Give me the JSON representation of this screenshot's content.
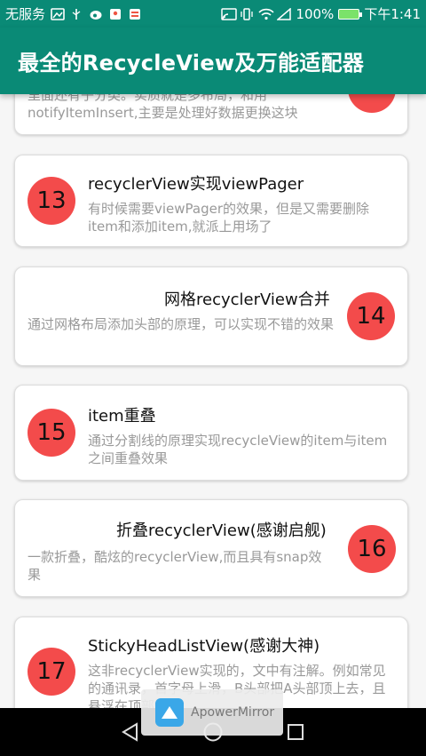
{
  "status_bar": {
    "carrier": "无服务",
    "battery": "100%",
    "time": "下午1:41"
  },
  "app_bar": {
    "title": "最全的RecycleView及万能适配器"
  },
  "cards": [
    {
      "number": "",
      "title": "",
      "description": "里面还有子分类。实质就是多布局，和用notifyItemInsert,主要是处理好数据更换这块"
    },
    {
      "number": "13",
      "title": "recyclerView实现viewPager",
      "description": "有时候需要viewPager的效果，但是又需要删除item和添加item,就派上用场了"
    },
    {
      "number": "14",
      "title": "网格recyclerView合并",
      "description": "通过网格布局添加头部的原理，可以实现不错的效果"
    },
    {
      "number": "15",
      "title": "item重叠",
      "description": "通过分割线的原理实现recycleView的item与item之间重叠效果"
    },
    {
      "number": "16",
      "title": "折叠recyclerView(感谢启舰)",
      "description": "一款折叠，酷炫的recyclerView,而且具有snap效果"
    },
    {
      "number": "17",
      "title": "StickyHeadListView(感谢大神)",
      "description": "这非recyclerView实现的，文中有注解。例如常见的通讯录，首字母上滑，B头部把A头部顶上去，且悬浮在顶部"
    }
  ],
  "overlay": {
    "label": "ApowerMirror"
  },
  "colors": {
    "accent": "#0a8a76",
    "badge": "#f34b4b"
  },
  "icons": {
    "nav_back": "triangle-back",
    "nav_home": "circle-home",
    "nav_recents": "square-recents"
  }
}
